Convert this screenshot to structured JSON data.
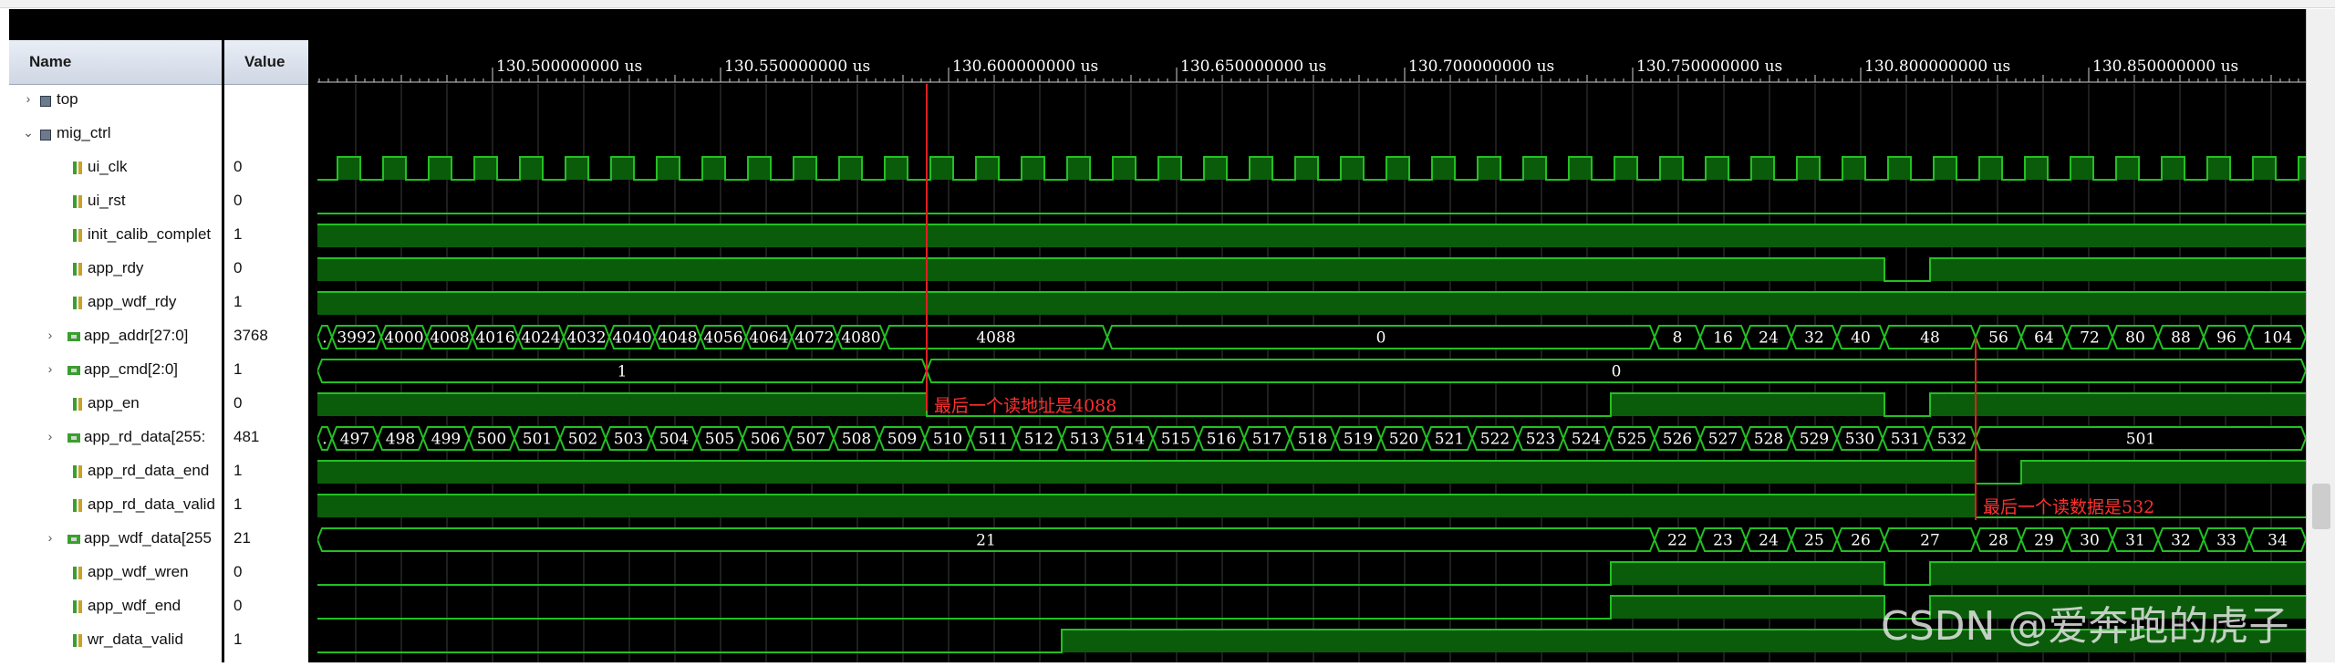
{
  "header": {
    "name": "Name",
    "value": "Value"
  },
  "signals": [
    {
      "name": "top",
      "value": "",
      "kind": "module",
      "expander": ">",
      "indent": 0
    },
    {
      "name": "mig_ctrl",
      "value": "",
      "kind": "module",
      "expander": "v",
      "indent": 0
    },
    {
      "name": "ui_clk",
      "value": "0",
      "kind": "bit",
      "expander": "",
      "indent": 2
    },
    {
      "name": "ui_rst",
      "value": "0",
      "kind": "bit",
      "expander": "",
      "indent": 2
    },
    {
      "name": "init_calib_complet",
      "value": "1",
      "kind": "bit",
      "expander": "",
      "indent": 2
    },
    {
      "name": "app_rdy",
      "value": "0",
      "kind": "bit",
      "expander": "",
      "indent": 2
    },
    {
      "name": "app_wdf_rdy",
      "value": "1",
      "kind": "bit",
      "expander": "",
      "indent": 2
    },
    {
      "name": "app_addr[27:0]",
      "value": "3768",
      "kind": "bus",
      "expander": ">",
      "indent": 1
    },
    {
      "name": "app_cmd[2:0]",
      "value": "1",
      "kind": "bus",
      "expander": ">",
      "indent": 1
    },
    {
      "name": "app_en",
      "value": "0",
      "kind": "bit",
      "expander": "",
      "indent": 2
    },
    {
      "name": "app_rd_data[255:",
      "value": "481",
      "kind": "bus",
      "expander": ">",
      "indent": 1
    },
    {
      "name": "app_rd_data_end",
      "value": "1",
      "kind": "bit",
      "expander": "",
      "indent": 2
    },
    {
      "name": "app_rd_data_valid",
      "value": "1",
      "kind": "bit",
      "expander": "",
      "indent": 2
    },
    {
      "name": "app_wdf_data[255",
      "value": "21",
      "kind": "bus",
      "expander": ">",
      "indent": 1
    },
    {
      "name": "app_wdf_wren",
      "value": "0",
      "kind": "bit",
      "expander": "",
      "indent": 2
    },
    {
      "name": "app_wdf_end",
      "value": "0",
      "kind": "bit",
      "expander": "",
      "indent": 2
    },
    {
      "name": "wr_data_valid",
      "value": "1",
      "kind": "bit",
      "expander": "",
      "indent": 2
    }
  ],
  "timeline": {
    "ticks": [
      "130.500000000 us",
      "130.550000000 us",
      "130.600000000 us",
      "130.650000000 us",
      "130.700000000 us",
      "130.750000000 us",
      "130.800000000 us",
      "130.850000000 us"
    ]
  },
  "bus_values": {
    "app_addr": [
      ".",
      "3992",
      "4000",
      "4008",
      "4016",
      "4024",
      "4032",
      "4040",
      "4048",
      "4056",
      "4064",
      "4072",
      "4080",
      "4088",
      "0",
      "8",
      "16",
      "24",
      "32",
      "40",
      "48",
      "56",
      "64",
      "72",
      "80",
      "88",
      "96",
      "104"
    ],
    "app_cmd": [
      "1",
      "0"
    ],
    "app_rd_data": [
      ".",
      "497",
      "498",
      "499",
      "500",
      "501",
      "502",
      "503",
      "504",
      "505",
      "506",
      "507",
      "508",
      "509",
      "510",
      "511",
      "512",
      "513",
      "514",
      "515",
      "516",
      "517",
      "518",
      "519",
      "520",
      "521",
      "522",
      "523",
      "524",
      "525",
      "526",
      "527",
      "528",
      "529",
      "530",
      "531",
      "532",
      "501"
    ],
    "app_wdf_data": [
      "21",
      "22",
      "23",
      "24",
      "25",
      "26",
      "27",
      "28",
      "29",
      "30",
      "31",
      "32",
      "33",
      "34"
    ]
  },
  "annotations": {
    "last_read_addr": "最后一个读地址是4088",
    "last_read_data": "最后一个读数据是532"
  },
  "colors": {
    "wave": "#0a5c0a",
    "line": "#22c022",
    "bg": "#000000",
    "marker": "#e02020",
    "annotation": "#ff3030"
  },
  "watermark": "CSDN @爱奔跑的虎子"
}
